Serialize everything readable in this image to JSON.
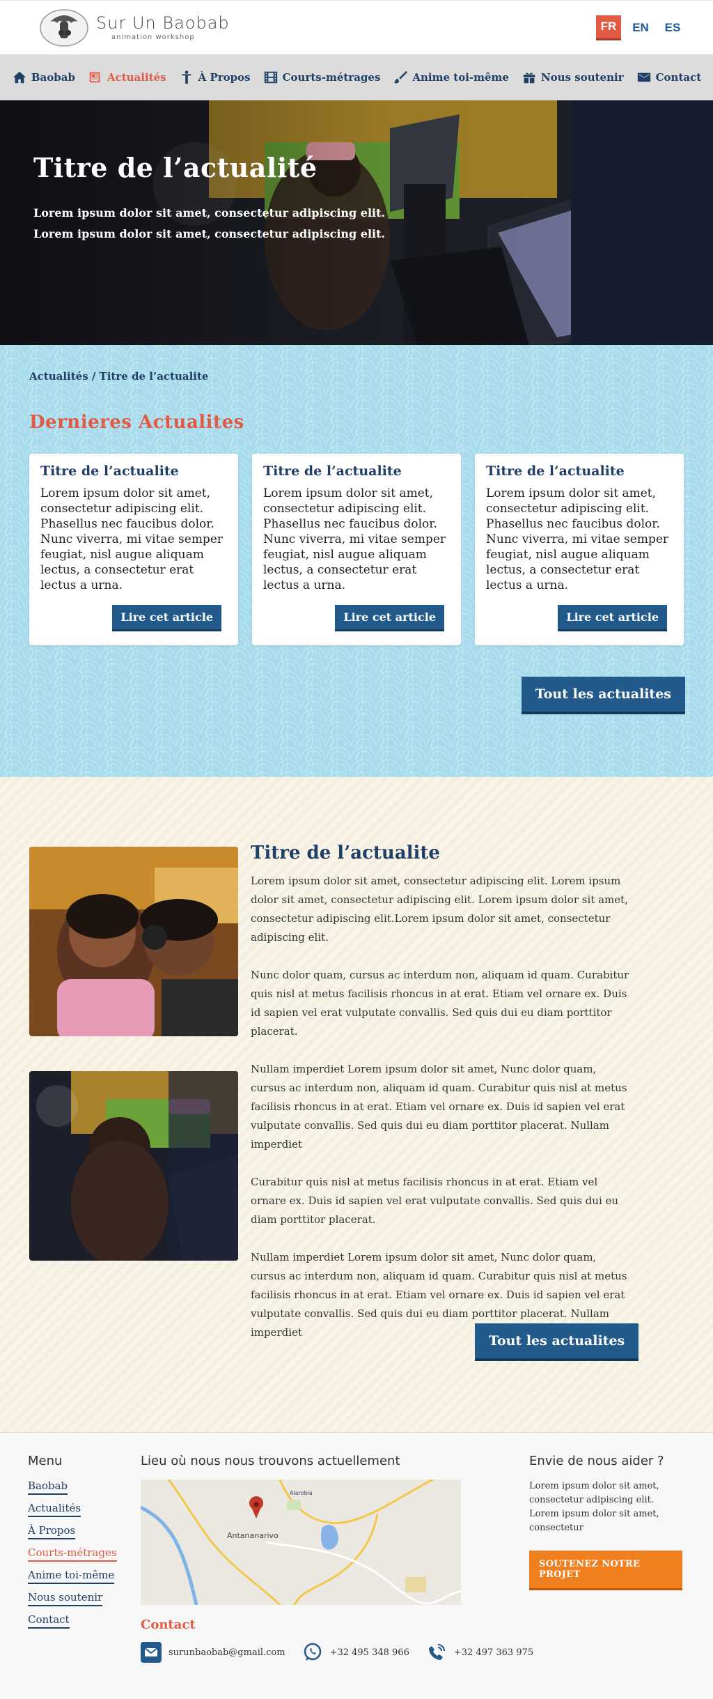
{
  "header": {
    "logo_title": "Sur Un Baobab",
    "logo_subtitle": "animation workshop",
    "languages": [
      {
        "label": "FR",
        "active": true
      },
      {
        "label": "EN",
        "active": false
      },
      {
        "label": "ES",
        "active": false
      }
    ]
  },
  "nav": {
    "items": [
      {
        "label": "Baobab",
        "icon": "home-icon"
      },
      {
        "label": "Actualités",
        "icon": "newspaper-icon",
        "active": true
      },
      {
        "label": "À Propos",
        "icon": "person-icon"
      },
      {
        "label": "Courts-métrages",
        "icon": "film-icon"
      },
      {
        "label": "Anime toi-même",
        "icon": "brush-icon"
      },
      {
        "label": "Nous soutenir",
        "icon": "gift-icon"
      },
      {
        "label": "Contact",
        "icon": "envelope-icon"
      }
    ]
  },
  "hero": {
    "title": "Titre de l’actualité",
    "line1": "Lorem ipsum dolor sit amet, consectetur adipiscing elit.",
    "line2": "Lorem ipsum dolor sit amet, consectetur adipiscing elit."
  },
  "news": {
    "breadcrumb": "Actualités / Titre de l’actualite",
    "section_title": "Dernieres Actualites",
    "cards": [
      {
        "title": "Titre de l’actualite",
        "text": "Lorem ipsum dolor sit amet, consectetur adipiscing elit. Phasellus nec faucibus dolor. Nunc viverra, mi vitae semper feugiat, nisl augue aliquam lectus, a consectetur erat lectus a urna.",
        "button": "Lire cet article"
      },
      {
        "title": "Titre de l’actualite",
        "text": "Lorem ipsum dolor sit amet, consectetur adipiscing elit. Phasellus nec faucibus dolor. Nunc viverra, mi vitae semper feugiat, nisl augue aliquam lectus, a consectetur erat lectus a urna.",
        "button": "Lire cet article"
      },
      {
        "title": "Titre de l’actualite",
        "text": "Lorem ipsum dolor sit amet, consectetur adipiscing elit. Phasellus nec faucibus dolor. Nunc viverra, mi vitae semper feugiat, nisl augue aliquam lectus, a consectetur erat lectus a urna.",
        "button": "Lire cet article"
      }
    ],
    "all_button": "Tout les actualites"
  },
  "article": {
    "title": "Titre de l’actualite",
    "paragraphs": [
      "Lorem ipsum dolor sit amet, consectetur adipiscing elit. Lorem ipsum dolor sit amet, consectetur adipiscing elit. Lorem ipsum dolor sit amet, consectetur adipiscing elit.Lorem ipsum dolor sit amet, consectetur adipiscing elit.",
      "Nunc dolor quam, cursus ac interdum non, aliquam id quam. Curabitur quis nisl at metus facilisis rhoncus in at erat. Etiam vel ornare ex. Duis id sapien vel erat vulputate convallis. Sed quis dui eu diam porttitor placerat.",
      "Nullam imperdiet Lorem ipsum dolor sit amet,  Nunc dolor quam, cursus ac interdum non, aliquam id quam. Curabitur quis nisl at metus facilisis rhoncus in at erat. Etiam vel ornare ex. Duis id sapien vel erat vulputate convallis. Sed quis dui eu diam porttitor placerat. Nullam imperdiet",
      "Curabitur quis nisl at metus facilisis rhoncus in at erat. Etiam vel ornare ex. Duis id sapien vel erat vulputate convallis. Sed quis dui eu diam porttitor placerat.",
      "Nullam imperdiet Lorem ipsum dolor sit amet,  Nunc dolor quam, cursus ac interdum non, aliquam id quam. Curabitur quis nisl at metus facilisis rhoncus in at erat. Etiam vel ornare ex. Duis id sapien vel erat vulputate convallis. Sed quis dui eu diam porttitor placerat. Nullam imperdiet"
    ],
    "all_button": "Tout les actualites"
  },
  "footer": {
    "menu_title": "Menu",
    "menu_items": [
      {
        "label": "Baobab"
      },
      {
        "label": "Actualités"
      },
      {
        "label": "À Propos"
      },
      {
        "label": "Courts-métrages",
        "active": true
      },
      {
        "label": "Anime toi-même"
      },
      {
        "label": "Nous soutenir"
      },
      {
        "label": "Contact"
      }
    ],
    "location_title": "Lieu où nous nous trouvons actuellement",
    "map_city": "Antananarivo",
    "map_district": "Alarobia",
    "contact_title": "Contact",
    "email": "surunbaobab@gmail.com",
    "whatsapp": "+32 495 348 966",
    "phone": "+32 497 363 975",
    "help_title": "Envie de nous aider ?",
    "help_text": "Lorem ipsum dolor sit amet, consectetur adipiscing elit. Lorem ipsum dolor sit amet, consectetur",
    "support_button": "SOUTENEZ NOTRE PROJET"
  },
  "colors": {
    "primary": "#235a8c",
    "accent": "#e25944",
    "orange": "#f07f1f",
    "news_bg": "#a8dcec",
    "article_bg": "#f4efdf"
  }
}
